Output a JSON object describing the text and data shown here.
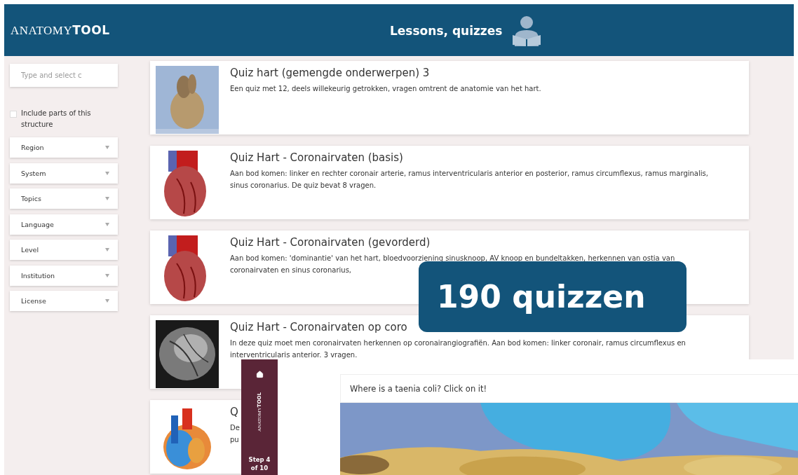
{
  "header": {
    "logo": {
      "light": "ANATOMY",
      "bold": "TOOL"
    },
    "title": "Lessons, quizzes"
  },
  "sidebar": {
    "search": {
      "placeholder": "Type and select c"
    },
    "include_parts": {
      "label": "Include parts of this structure",
      "checked": false
    },
    "filters": [
      "Region",
      "System",
      "Topics",
      "Language",
      "Level",
      "Institution",
      "License"
    ]
  },
  "quizzes": [
    {
      "kind": "picture",
      "title": "Quiz hart (gemengde onderwerpen) 3",
      "description_lines": [
        "Een quiz met 12, deels willekeurig getrokken, vragen omtrent de anatomie van het hart."
      ]
    },
    {
      "kind": "picture",
      "title": "Quiz Hart - Coronairvaten (basis)",
      "description_lines": [
        "Aan bod komen: linker en rechter coronair arterie, ramus interventricularis anterior en posterior, ramus circumflexus, ramus marginalis,",
        "sinus coronarius. De quiz bevat 8 vragen."
      ]
    },
    {
      "kind": "picture",
      "title": "Quiz Hart - Coronairvaten (gevorderd)",
      "description_lines": [
        "Aan bod komen: 'dominantie' van het hart, bloedvoorziening sinusknoop, AV knoop en bundeltakken, herkennen van ostia van",
        "coronairvaten en sinus coronarius,"
      ]
    },
    {
      "kind": "picture",
      "title": "Quiz Hart - Coronairvaten op coro",
      "description_lines": [
        "In deze quiz moet men coronairvaten herkennen op coronairangiografiën. Aan bod komen: linker coronair, ramus circumflexus en",
        "interventricularis anterior. 3 vragen."
      ]
    },
    {
      "kind": "picture",
      "title": "Q",
      "description_lines": [
        "De",
        "pu"
      ]
    }
  ],
  "badge": "190 quizzen",
  "viewer": {
    "logo": {
      "light": "ANATOMY",
      "bold": "TOOL"
    },
    "step": "Step 4 of 10",
    "question": "Where is a taenia coli? Click on it!"
  }
}
